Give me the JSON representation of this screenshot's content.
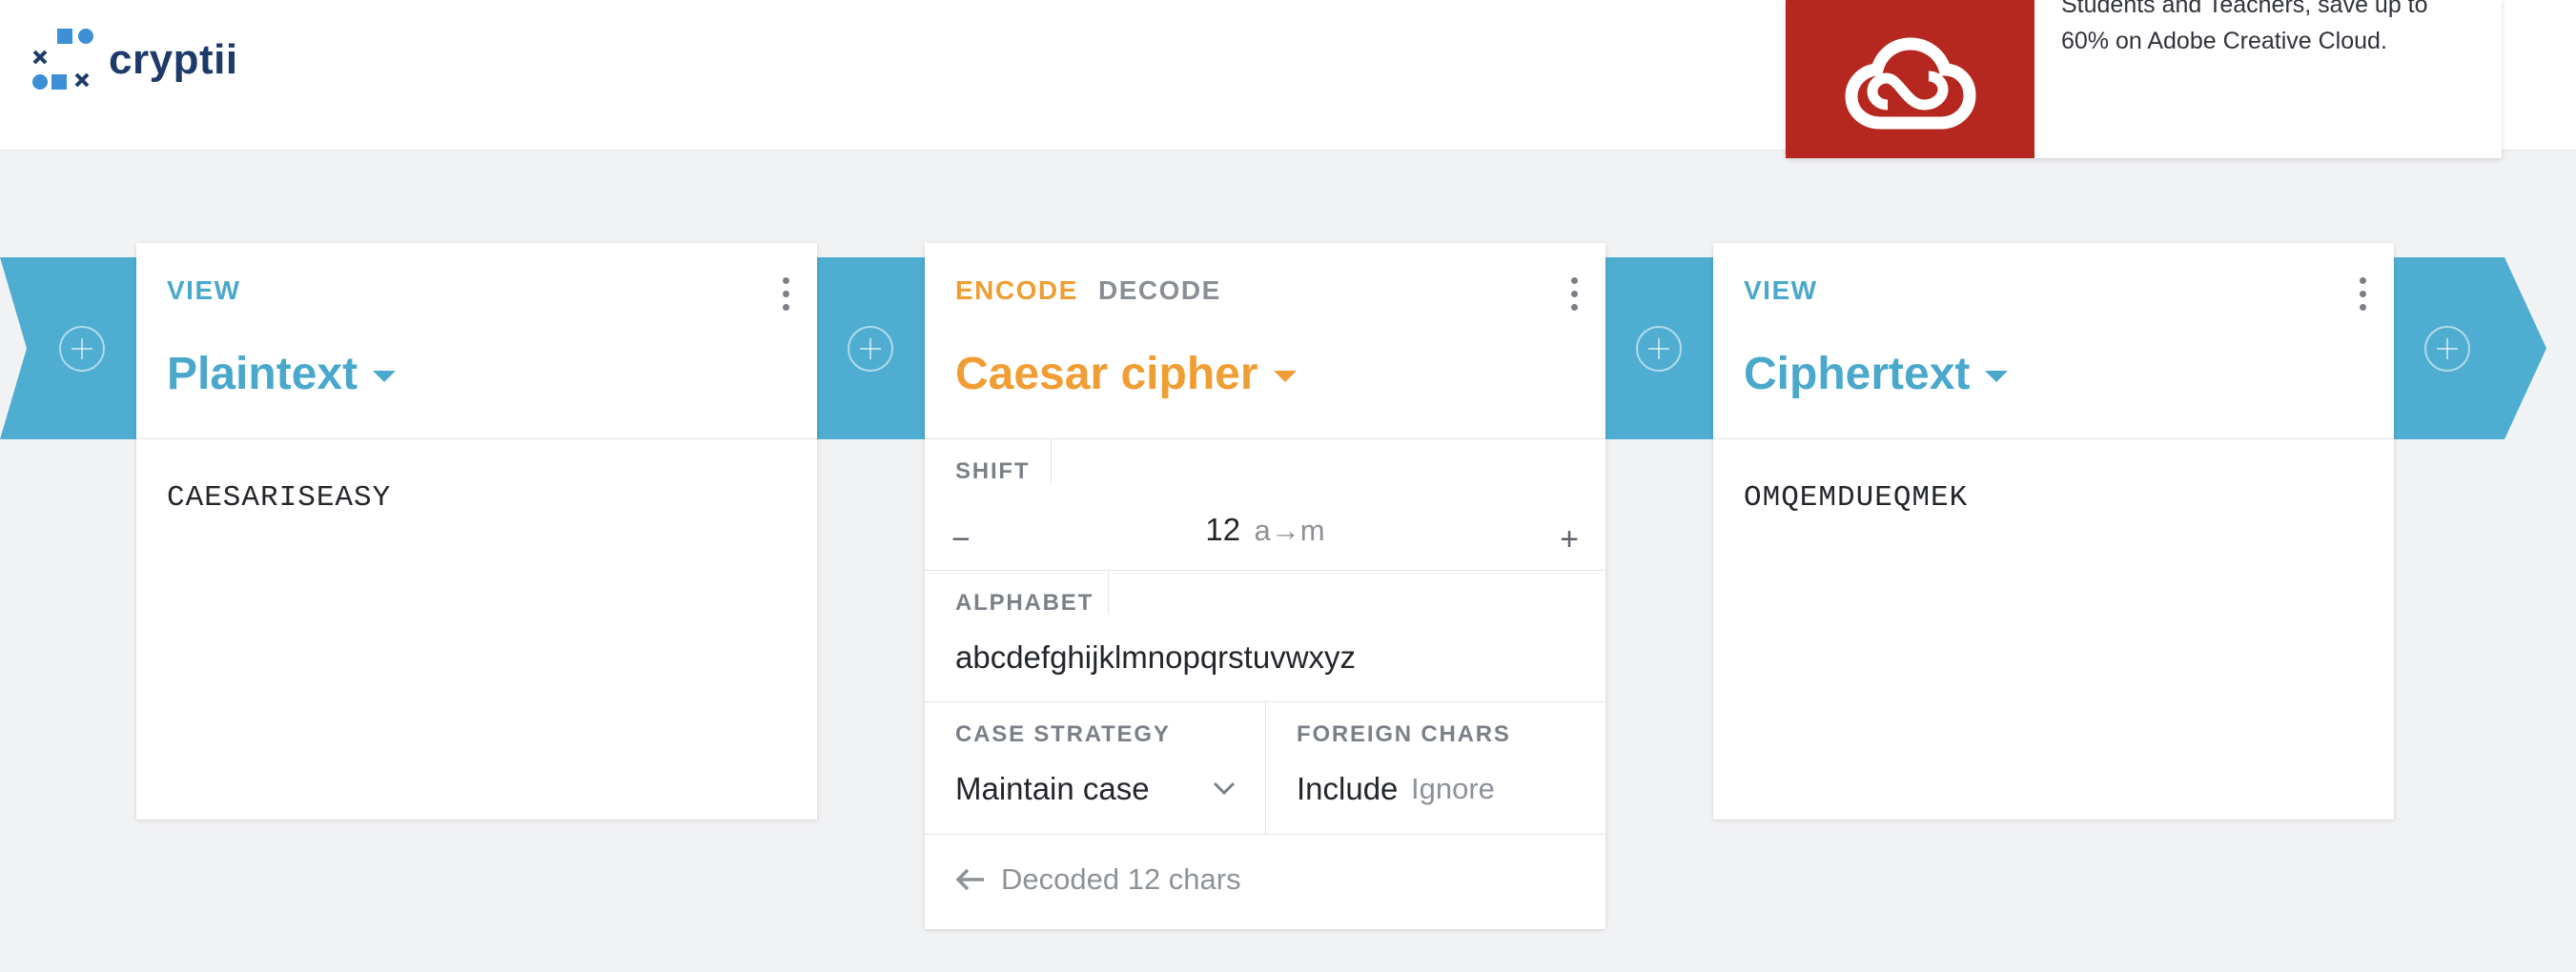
{
  "header": {
    "logo_text": "cryptii"
  },
  "ad": {
    "text": "Students and Teachers, save up to 60% on Adobe Creative Cloud."
  },
  "colors": {
    "accent_blue": "#4eadd0",
    "accent_orange": "#f09d34",
    "ad_red": "#b6281f"
  },
  "left_card": {
    "mode_label": "VIEW",
    "title": "Plaintext",
    "content": "CAESARISEASY"
  },
  "middle_card": {
    "encode_label": "ENCODE",
    "decode_label": "DECODE",
    "title": "Caesar cipher",
    "shift": {
      "label": "SHIFT",
      "minus": "−",
      "plus": "+",
      "value": "12",
      "mapping": "a→m"
    },
    "alphabet": {
      "label": "ALPHABET",
      "value": "abcdefghijklmnopqrstuvwxyz"
    },
    "case_strategy": {
      "label": "CASE STRATEGY",
      "value": "Maintain case"
    },
    "foreign_chars": {
      "label": "FOREIGN CHARS",
      "include": "Include",
      "ignore": "Ignore"
    },
    "status": "Decoded 12 chars"
  },
  "right_card": {
    "mode_label": "VIEW",
    "title": "Ciphertext",
    "content": "OMQEMDUEQMEK"
  },
  "icons": [
    "logo-icon",
    "creative-cloud-icon",
    "add-icon",
    "more-vertical-icon",
    "caret-down-icon",
    "chevron-down-icon",
    "arrow-left-icon"
  ]
}
